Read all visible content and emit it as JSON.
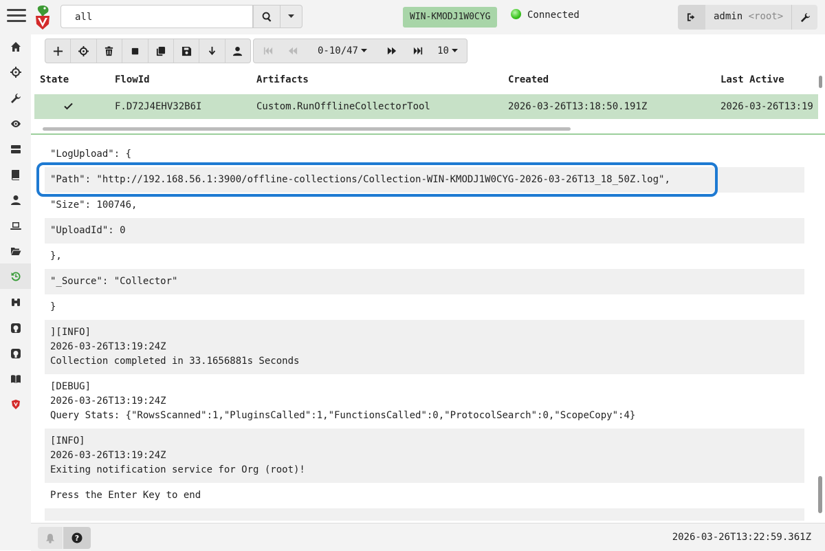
{
  "search": {
    "value": "all"
  },
  "client": {
    "hostname": "WIN-KMODJ1W0CYG",
    "status": "Connected"
  },
  "user": {
    "name": "admin",
    "org": "<root>"
  },
  "pager": {
    "range": "0-10/47",
    "page_size": "10"
  },
  "table": {
    "headers": [
      "State",
      "FlowId",
      "Artifacts",
      "Created",
      "Last Active"
    ],
    "row": {
      "state_icon": "check-icon",
      "flow_id": "F.D72J4EHV32B6I",
      "artifacts": "Custom.RunOfflineCollectorTool",
      "created": "2026-03-26T13:18:50.191Z",
      "last_active": "2026-03-26T13:19"
    }
  },
  "log": {
    "lines": [
      "\"LogUpload\": {",
      "\"Path\": \"http://192.168.56.1:3900/offline-collections/Collection-WIN-KMODJ1W0CYG-2026-03-26T13_18_50Z.log\",",
      "\"Size\": 100746,",
      "\"UploadId\": 0",
      "},",
      "\"_Source\": \"Collector\"",
      "}",
      "][INFO]",
      "2026-03-26T13:19:24Z",
      "Collection completed in 33.1656881s Seconds",
      "[DEBUG]",
      "2026-03-26T13:19:24Z",
      "Query Stats: {\"RowsScanned\":1,\"PluginsCalled\":1,\"FunctionsCalled\":0,\"ProtocolSearch\":0,\"ScopeCopy\":4}",
      "[INFO]",
      "2026-03-26T13:19:24Z",
      "Exiting notification service for Org (root)!",
      "Press the Enter Key to end"
    ]
  },
  "footer": {
    "timestamp": "2026-03-26T13:22:59.361Z"
  },
  "colors": {
    "accent": "#1e7ad2",
    "selected_row": "#c7e1c7",
    "client_badge": "#a8d5a8",
    "status_ok": "#38c21c"
  }
}
